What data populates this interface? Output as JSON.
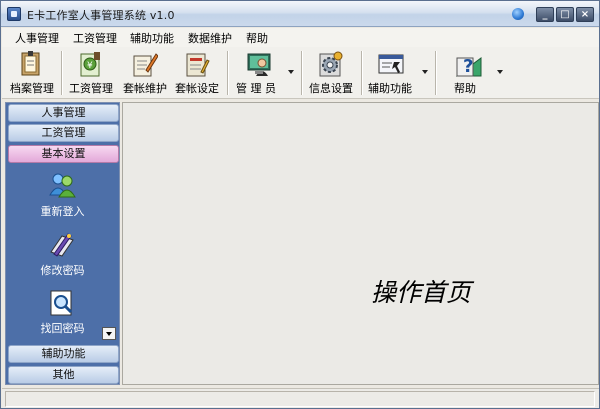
{
  "window": {
    "title": "E卡工作室人事管理系统 v1.0",
    "minimize": "_",
    "maximize": "□",
    "close": "×"
  },
  "menu": [
    "人事管理",
    "工资管理",
    "辅助功能",
    "数据维护",
    "帮助"
  ],
  "toolbar": {
    "items": [
      {
        "label": "档案管理",
        "icon": "file-folder-icon"
      },
      {
        "label": "工资管理",
        "icon": "salary-icon"
      },
      {
        "label": "套帐维护",
        "icon": "book-edit-icon"
      },
      {
        "label": "套帐设定",
        "icon": "book-settings-icon"
      },
      {
        "label": "管 理 员",
        "icon": "administrator-icon",
        "dropdown": true
      },
      {
        "label": "信息设置",
        "icon": "gear-icon"
      },
      {
        "label": "辅助功能",
        "icon": "tools-icon",
        "dropdown": true
      },
      {
        "label": "帮助",
        "icon": "help-icon",
        "dropdown": true
      }
    ]
  },
  "sidebar": {
    "groups": [
      "人事管理",
      "工资管理",
      "基本设置"
    ],
    "active_group": "基本设置",
    "items": [
      {
        "label": "重新登入",
        "icon": "users-login-icon"
      },
      {
        "label": "修改密码",
        "icon": "edit-password-icon"
      },
      {
        "label": "找回密码",
        "icon": "search-password-icon"
      }
    ],
    "bottom_groups": [
      "辅助功能",
      "其他"
    ]
  },
  "main": {
    "title": "操作首页"
  },
  "colors": {
    "sidebar_bg": "#4d6fa8",
    "active_group": "#e3a9d9",
    "group_header": "#b9cce6"
  }
}
